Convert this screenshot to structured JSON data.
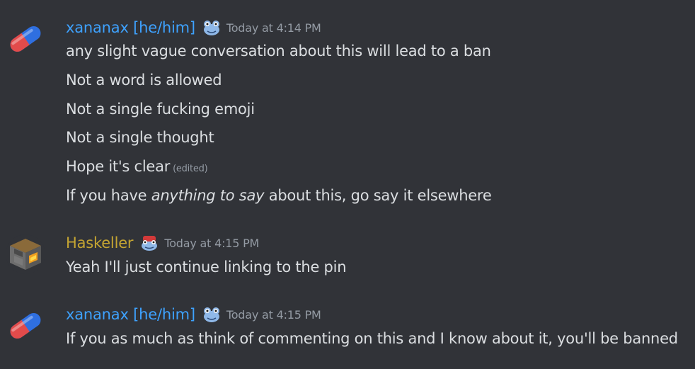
{
  "colors": {
    "background": "#313338",
    "text": "#dbdee1",
    "muted": "#949ba4",
    "username_blue": "#3ea2ff",
    "username_gold": "#c5a532"
  },
  "messages": [
    {
      "author": "xananax [he/him]",
      "avatar_icon": "pill-capsule-icon",
      "role_icon": "frog-icon",
      "timestamp": "Today at 4:14 PM",
      "lines": {
        "l1": "any slight vague conversation about this will lead to a ban",
        "l2": "Not a word is allowed",
        "l3": "Not a single fucking emoji",
        "l4": "Not a single thought",
        "l5": "Hope it's clear",
        "l5_edited": "(edited)",
        "l6_pre": "If you have ",
        "l6_em": "anything to say",
        "l6_post": " about this, go say it elsewhere"
      }
    },
    {
      "author": "Haskeller",
      "avatar_icon": "furnace-block-icon",
      "role_icon": "frog-red-hat-icon",
      "timestamp": "Today at 4:15 PM",
      "lines": {
        "l1": "Yeah I'll just continue linking to the pin"
      }
    },
    {
      "author": "xananax [he/him]",
      "avatar_icon": "pill-capsule-icon",
      "role_icon": "frog-icon",
      "timestamp": "Today at 4:15 PM",
      "lines": {
        "l1": "If you as much as think of commenting on this and I know about it, you'll be banned"
      }
    }
  ]
}
